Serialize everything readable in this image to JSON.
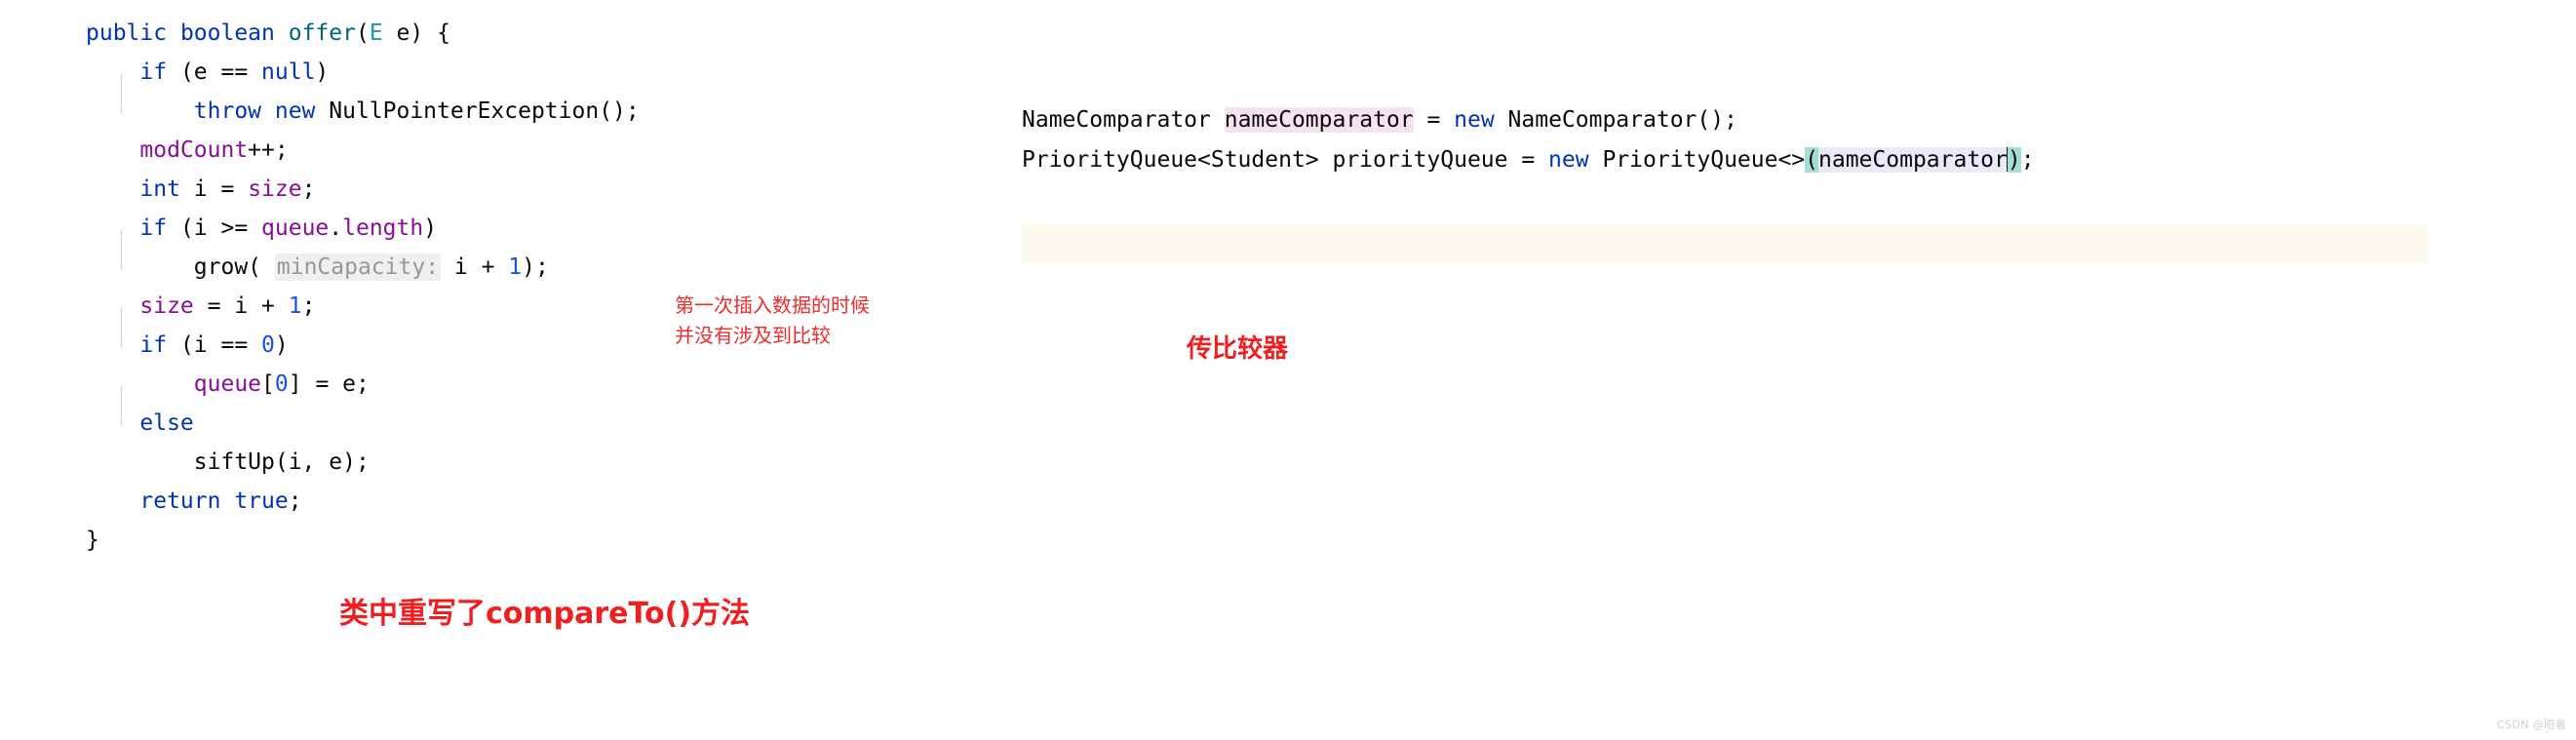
{
  "left_code": {
    "language": "java",
    "lines": [
      {
        "indent": 0,
        "tokens": [
          {
            "t": "public ",
            "c": "kw"
          },
          {
            "t": "boolean ",
            "c": "kw"
          },
          {
            "t": "offer",
            "c": "meth"
          },
          {
            "t": "(",
            "c": "plain"
          },
          {
            "t": "E",
            "c": "type"
          },
          {
            "t": " e) {",
            "c": "plain"
          }
        ]
      },
      {
        "indent": 1,
        "tokens": [
          {
            "t": "if",
            "c": "kw"
          },
          {
            "t": " (e == ",
            "c": "plain"
          },
          {
            "t": "null",
            "c": "kw"
          },
          {
            "t": ")",
            "c": "plain"
          }
        ]
      },
      {
        "indent": 2,
        "tokens": [
          {
            "t": "throw new",
            "c": "kw"
          },
          {
            "t": " NullPointerException();",
            "c": "plain"
          }
        ]
      },
      {
        "indent": 1,
        "tokens": [
          {
            "t": "modCount",
            "c": "field"
          },
          {
            "t": "++;",
            "c": "plain"
          }
        ]
      },
      {
        "indent": 1,
        "tokens": [
          {
            "t": "int",
            "c": "kw"
          },
          {
            "t": " i = ",
            "c": "plain"
          },
          {
            "t": "size",
            "c": "field"
          },
          {
            "t": ";",
            "c": "plain"
          }
        ]
      },
      {
        "indent": 1,
        "tokens": [
          {
            "t": "if",
            "c": "kw"
          },
          {
            "t": " (i >= ",
            "c": "plain"
          },
          {
            "t": "queue",
            "c": "field"
          },
          {
            "t": ".",
            "c": "plain"
          },
          {
            "t": "length",
            "c": "field"
          },
          {
            "t": ")",
            "c": "plain"
          }
        ]
      },
      {
        "indent": 2,
        "tokens": [
          {
            "t": "grow( ",
            "c": "plain"
          },
          {
            "t": "minCapacity:",
            "c": "hint"
          },
          {
            "t": " i + ",
            "c": "plain"
          },
          {
            "t": "1",
            "c": "num"
          },
          {
            "t": ");",
            "c": "plain"
          }
        ]
      },
      {
        "indent": 1,
        "tokens": [
          {
            "t": "size",
            "c": "field"
          },
          {
            "t": " = i + ",
            "c": "plain"
          },
          {
            "t": "1",
            "c": "num"
          },
          {
            "t": ";",
            "c": "plain"
          }
        ]
      },
      {
        "indent": 1,
        "tokens": [
          {
            "t": "if",
            "c": "kw"
          },
          {
            "t": " (i == ",
            "c": "plain"
          },
          {
            "t": "0",
            "c": "num"
          },
          {
            "t": ")",
            "c": "plain"
          }
        ]
      },
      {
        "indent": 2,
        "tokens": [
          {
            "t": "queue",
            "c": "field"
          },
          {
            "t": "[",
            "c": "plain"
          },
          {
            "t": "0",
            "c": "num"
          },
          {
            "t": "] = e;",
            "c": "plain"
          }
        ]
      },
      {
        "indent": 1,
        "tokens": [
          {
            "t": "else",
            "c": "kw"
          }
        ]
      },
      {
        "indent": 2,
        "tokens": [
          {
            "t": "siftUp(i, e);",
            "c": "plain"
          }
        ]
      },
      {
        "indent": 1,
        "tokens": [
          {
            "t": "return true",
            "c": "kw"
          },
          {
            "t": ";",
            "c": "plain"
          }
        ]
      },
      {
        "indent": 0,
        "tokens": [
          {
            "t": "}",
            "c": "plain"
          }
        ]
      }
    ],
    "plain_text": "public boolean offer(E e) {\n    if (e == null)\n        throw new NullPointerException();\n    modCount++;\n    int i = size;\n    if (i >= queue.length)\n        grow( minCapacity: i + 1);\n    size = i + 1;\n    if (i == 0)\n        queue[0] = e;\n    else\n        siftUp(i, e);\n    return true;\n}"
  },
  "right_code": {
    "language": "java",
    "lines": [
      {
        "tokens": [
          {
            "t": "NameComparator ",
            "c": "plain"
          },
          {
            "t": "nameComparator",
            "c": "plain",
            "hl": "pink"
          },
          {
            "t": " = ",
            "c": "plain"
          },
          {
            "t": "new",
            "c": "kw"
          },
          {
            "t": " NameComparator();",
            "c": "plain"
          }
        ]
      },
      {
        "caret_line": true,
        "tokens": [
          {
            "t": "PriorityQueue<Student> priorityQueue = ",
            "c": "plain"
          },
          {
            "t": "new",
            "c": "kw"
          },
          {
            "t": " PriorityQueue<>",
            "c": "plain"
          },
          {
            "t": "(",
            "c": "plain",
            "hl": "brace"
          },
          {
            "t": "nameComparator",
            "c": "plain",
            "hl": "lavender"
          },
          {
            "t": "caret",
            "c": "caret"
          },
          {
            "t": ")",
            "c": "plain",
            "hl": "brace"
          },
          {
            "t": ";",
            "c": "plain"
          }
        ]
      }
    ],
    "plain_text": "NameComparator nameComparator = new NameComparator();\nPriorityQueue<Student> priorityQueue = new PriorityQueue<>(nameComparator);"
  },
  "annotations": {
    "note_left": "第一次插入数据的时候\n并没有涉及到比较",
    "bold_bottom": "类中重写了compareTo()方法",
    "bold_right": "传比较器"
  },
  "watermark": "CSDN @昭著",
  "colors": {
    "background": "#ffffff",
    "keyword": "#0033B3",
    "field": "#871094",
    "method": "#00627A",
    "number": "#1750EB",
    "type_param": "#20999D",
    "param_hint_text": "#989898",
    "param_hint_bg": "#efefef",
    "annotation_red": "#f02b2b",
    "caret_line_bg": "#fcfaef",
    "identifier_highlight": "#f7e3ef",
    "usage_highlight": "#eaeafb",
    "brace_match": "#a3ded6",
    "indent_guide": "#d0d0d0",
    "watermark": "#cfcfcf"
  }
}
